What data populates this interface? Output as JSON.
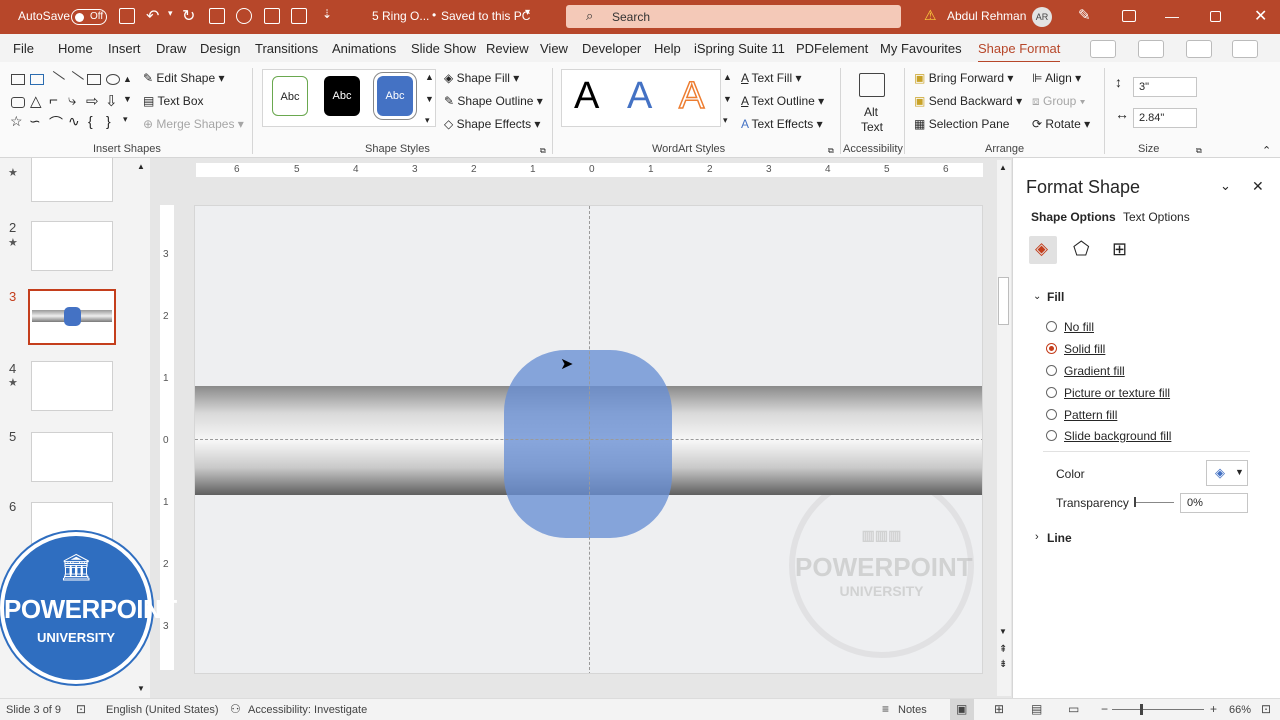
{
  "titlebar": {
    "autosave": "AutoSave",
    "toggle": "Off",
    "doc": "5 Ring O...",
    "saved": "Saved to this PC",
    "search": "Search",
    "user": "Abdul Rehman",
    "initials": "AR"
  },
  "menu": [
    "File",
    "Home",
    "Insert",
    "Draw",
    "Design",
    "Transitions",
    "Animations",
    "Slide Show",
    "Review",
    "View",
    "Developer",
    "Help",
    "iSpring Suite 11",
    "PDFelement",
    "My Favourites",
    "Shape Format"
  ],
  "ribbon": {
    "insert_shapes": {
      "label": "Insert Shapes",
      "edit_shape": "Edit Shape",
      "text_box": "Text Box",
      "merge_shapes": "Merge Shapes"
    },
    "shape_styles": {
      "label": "Shape Styles",
      "styles": [
        "Abc",
        "Abc",
        "Abc"
      ],
      "fill": "Shape Fill",
      "outline": "Shape Outline",
      "effects": "Shape Effects"
    },
    "wordart": {
      "label": "WordArt Styles",
      "letters": [
        "A",
        "A",
        "A"
      ],
      "fill": "Text Fill",
      "outline": "Text Outline",
      "effects": "Text Effects"
    },
    "accessibility": {
      "label": "Accessibility",
      "alt1": "Alt",
      "alt2": "Text"
    },
    "arrange": {
      "label": "Arrange",
      "bring": "Bring Forward",
      "send": "Send Backward",
      "pane": "Selection Pane",
      "align": "Align",
      "group": "Group",
      "rotate": "Rotate"
    },
    "size": {
      "label": "Size",
      "height": "3\"",
      "width": "2.84\""
    }
  },
  "ruler_h": [
    "6",
    "5",
    "4",
    "3",
    "2",
    "1",
    "0",
    "1",
    "2",
    "3",
    "4",
    "5",
    "6"
  ],
  "ruler_v": [
    "3",
    "2",
    "1",
    "0",
    "1",
    "2",
    "3"
  ],
  "slides": [
    {
      "num": "",
      "star": "★"
    },
    {
      "num": "2",
      "star": "★"
    },
    {
      "num": "3",
      "star": ""
    },
    {
      "num": "4",
      "star": "★"
    },
    {
      "num": "5",
      "star": ""
    },
    {
      "num": "6",
      "star": ""
    }
  ],
  "watermark": {
    "line1": "POWERPOINT",
    "line2": "UNIVERSITY"
  },
  "badge": {
    "line1": "POWERPOINT",
    "line2": "UNIVERSITY"
  },
  "pane": {
    "title": "Format Shape",
    "tab1": "Shape Options",
    "tab2": "Text Options",
    "section_fill": "Fill",
    "options": [
      "No fill",
      "Solid fill",
      "Gradient fill",
      "Picture or texture fill",
      "Pattern fill",
      "Slide background fill"
    ],
    "selected": "Solid fill",
    "color_label": "Color",
    "transparency_label": "Transparency",
    "transparency_value": "0%",
    "section_line": "Line"
  },
  "status": {
    "slide": "Slide 3 of 9",
    "language": "English (United States)",
    "accessibility": "Accessibility: Investigate",
    "notes": "Notes",
    "zoom": "66%"
  },
  "colors": {
    "accent": "#b7472a",
    "shape_fill": "#688ed4"
  }
}
